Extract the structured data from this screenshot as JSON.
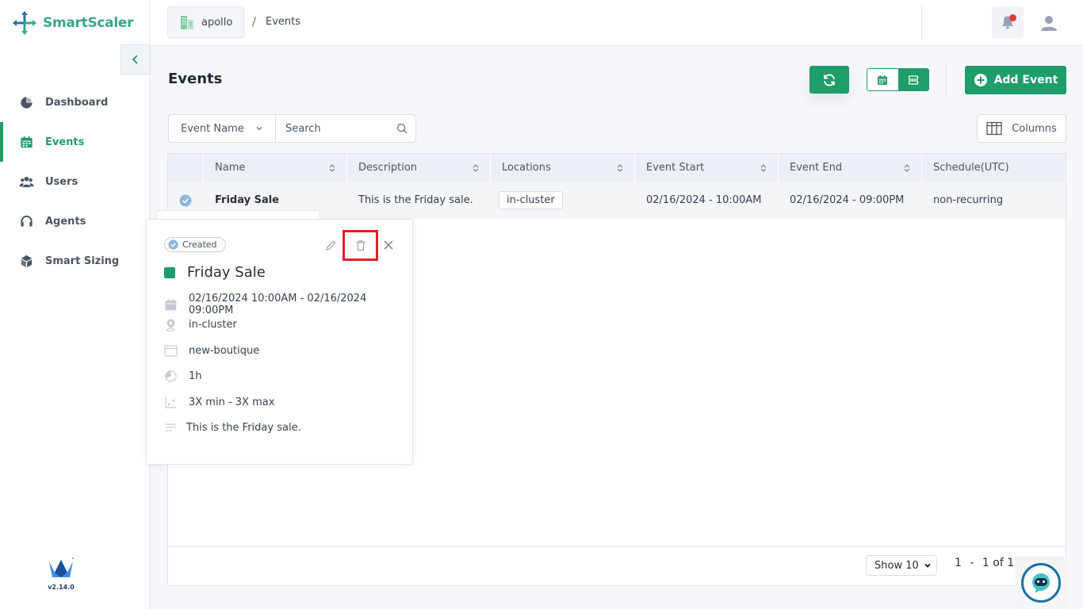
{
  "app": {
    "name": "SmartScaler",
    "version": "v2.14.0"
  },
  "sidebar": {
    "items": [
      {
        "label": "Dashboard",
        "icon": "pie-chart-icon"
      },
      {
        "label": "Events",
        "icon": "calendar-icon",
        "active": true
      },
      {
        "label": "Users",
        "icon": "users-icon"
      },
      {
        "label": "Agents",
        "icon": "headset-icon"
      },
      {
        "label": "Smart Sizing",
        "icon": "cube-icon"
      }
    ]
  },
  "header": {
    "project": "apollo",
    "breadcrumb_sep": "/",
    "breadcrumb_current": "Events"
  },
  "main": {
    "title": "Events",
    "add_label": "Add Event",
    "columns_label": "Columns",
    "filter": {
      "field": "Event Name",
      "search_placeholder": "Search"
    }
  },
  "table": {
    "headers": [
      "Name",
      "Description",
      "Locations",
      "Event Start",
      "Event End",
      "Schedule(UTC)"
    ],
    "rows": [
      {
        "name": "Friday Sale",
        "description": "This is the Friday sale.",
        "location": "in-cluster",
        "start": "02/16/2024 - 10:00AM",
        "end": "02/16/2024 - 09:00PM",
        "schedule": "non-recurring"
      }
    ],
    "footer": {
      "show": "Show 10",
      "page_start": "1",
      "dash": "-",
      "page_info": "1 of 1"
    }
  },
  "popup": {
    "status": "Created",
    "title": "Friday Sale",
    "datetime": "02/16/2024 10:00AM - 02/16/2024 09:00PM",
    "location": "in-cluster",
    "app": "new-boutique",
    "duration": "1h",
    "scale": "3X min - 3X max",
    "description": "This is the Friday sale."
  },
  "colors": {
    "accent": "#1f9d6a",
    "highlight": "#e31e24",
    "notification": "#e53935"
  }
}
